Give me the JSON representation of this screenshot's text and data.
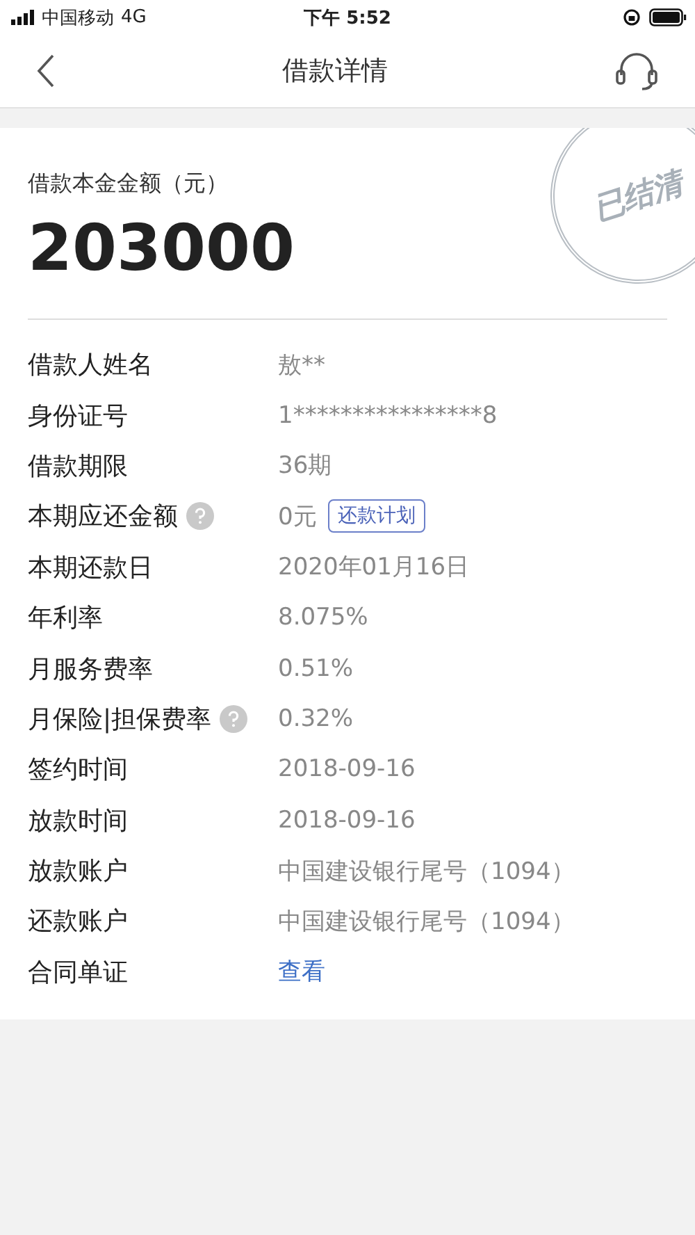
{
  "status_bar": {
    "carrier": "中国移动",
    "network": "4G",
    "time": "下午 5:52"
  },
  "nav": {
    "title": "借款详情"
  },
  "stamp": {
    "text": "已结清"
  },
  "principal": {
    "label": "借款本金金额（元）",
    "amount": "203000"
  },
  "rows": [
    {
      "label": "借款人姓名",
      "value": "敖**",
      "help": false,
      "kind": "text"
    },
    {
      "label": "身份证号",
      "value": "1****************8",
      "help": false,
      "kind": "text"
    },
    {
      "label": "借款期限",
      "value": "36期",
      "help": false,
      "kind": "text"
    },
    {
      "label": "本期应还金额",
      "value": "0元",
      "help": true,
      "kind": "text",
      "action": "还款计划"
    },
    {
      "label": "本期还款日",
      "value": "2020年01月16日",
      "help": false,
      "kind": "text"
    },
    {
      "label": "年利率",
      "value": "8.075%",
      "help": false,
      "kind": "text"
    },
    {
      "label": "月服务费率",
      "value": "0.51%",
      "help": false,
      "kind": "text"
    },
    {
      "label": "月保险|担保费率",
      "value": "0.32%",
      "help": true,
      "kind": "text"
    },
    {
      "label": "签约时间",
      "value": "2018-09-16",
      "help": false,
      "kind": "text"
    },
    {
      "label": "放款时间",
      "value": "2018-09-16",
      "help": false,
      "kind": "text"
    },
    {
      "label": "放款账户",
      "value": "中国建设银行尾号（1094）",
      "help": false,
      "kind": "text"
    },
    {
      "label": "还款账户",
      "value": "中国建设银行尾号（1094）",
      "help": false,
      "kind": "text"
    },
    {
      "label": "合同单证",
      "value": "查看",
      "help": false,
      "kind": "link"
    }
  ]
}
